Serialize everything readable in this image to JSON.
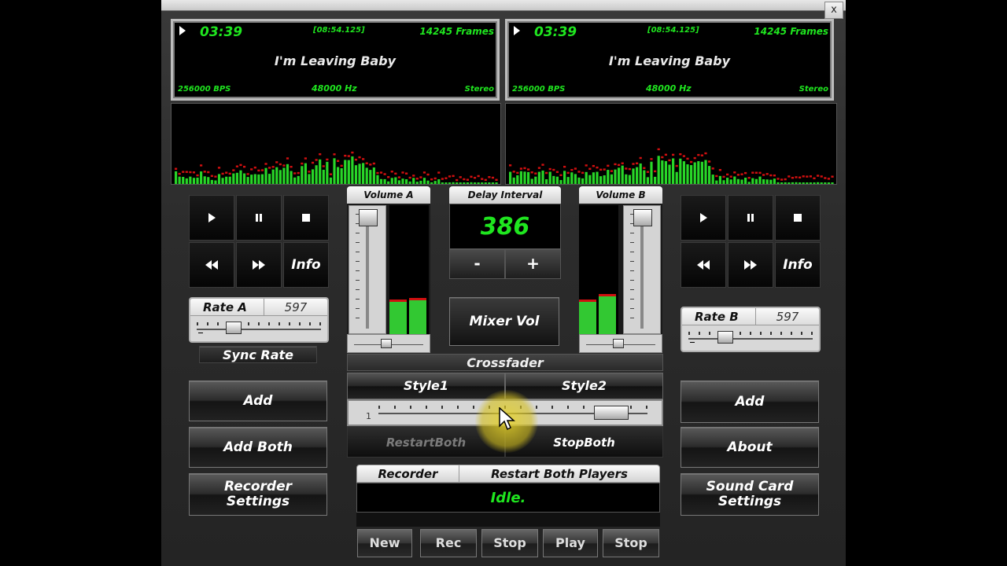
{
  "window": {
    "close_label": "x"
  },
  "deck_a": {
    "time": "03:39",
    "position": "[08:54.125]",
    "frames": "14245 Frames",
    "title": "I'm Leaving Baby",
    "bps": "256000 BPS",
    "hz": "48000 Hz",
    "mode": "Stereo",
    "info_label": "Info",
    "rate_label": "Rate A",
    "rate_value": "597",
    "sync_label": "Sync Rate",
    "add_label": "Add",
    "add_both_label": "Add Both",
    "recorder_settings_l1": "Recorder",
    "recorder_settings_l2": "Settings"
  },
  "deck_b": {
    "time": "03:39",
    "position": "[08:54.125]",
    "frames": "14245 Frames",
    "title": "I'm Leaving Baby",
    "bps": "256000 BPS",
    "hz": "48000 Hz",
    "mode": "Stereo",
    "info_label": "Info",
    "rate_label": "Rate B",
    "rate_value": "597",
    "add_label": "Add",
    "about_label": "About",
    "sound_card_l1": "Sound Card",
    "sound_card_l2": "Settings"
  },
  "mixer": {
    "volume_a_label": "Volume A",
    "volume_b_label": "Volume B",
    "delay_label": "Delay Interval",
    "delay_value": "386",
    "minus_label": "-",
    "plus_label": "+",
    "mixer_vol_label": "Mixer Vol",
    "volume_a_meter": [
      0.27,
      0.28
    ],
    "volume_b_meter": [
      0.27,
      0.31
    ]
  },
  "crossfader": {
    "title": "Crossfader",
    "style1": "Style1",
    "style2": "Style2",
    "min_tick": "1",
    "restart_both": "RestartBoth",
    "stop_both": "StopBoth",
    "position": 0.92
  },
  "recorder": {
    "label": "Recorder",
    "restart_label": "Restart Both Players",
    "status": "Idle.",
    "buttons": [
      "New",
      "Rec",
      "Stop",
      "Play",
      "Stop"
    ]
  },
  "colors": {
    "lcd_green": "#1fe61f",
    "meter_green": "#32c832",
    "peak_red": "#d01010",
    "cursor_highlight": "#e6d228"
  }
}
